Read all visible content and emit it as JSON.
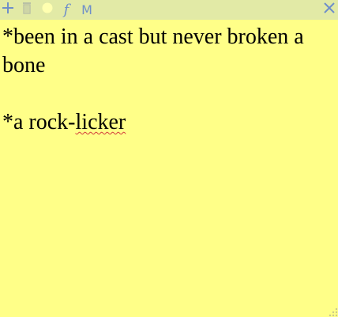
{
  "toolbar": {
    "add_icon": "plus-icon",
    "trash_icon": "trash-icon",
    "color_icon": "color-dot-icon",
    "font_icon": "font-icon",
    "font_glyph": "f",
    "menu_icon": "menu-icon",
    "menu_glyph": "M",
    "close_icon": "close-icon"
  },
  "note": {
    "line1": "*been in a cast but never broken a bone",
    "line2": "",
    "line3_before": "*a rock-",
    "line3_misspelled": "licker"
  },
  "colors": {
    "note_background": "#ffff88",
    "toolbar_background": "#e2eaa6",
    "icon_color": "#6f8fc9",
    "color_dot": "#ffffb0",
    "spellcheck_underline": "#d23b3b"
  }
}
